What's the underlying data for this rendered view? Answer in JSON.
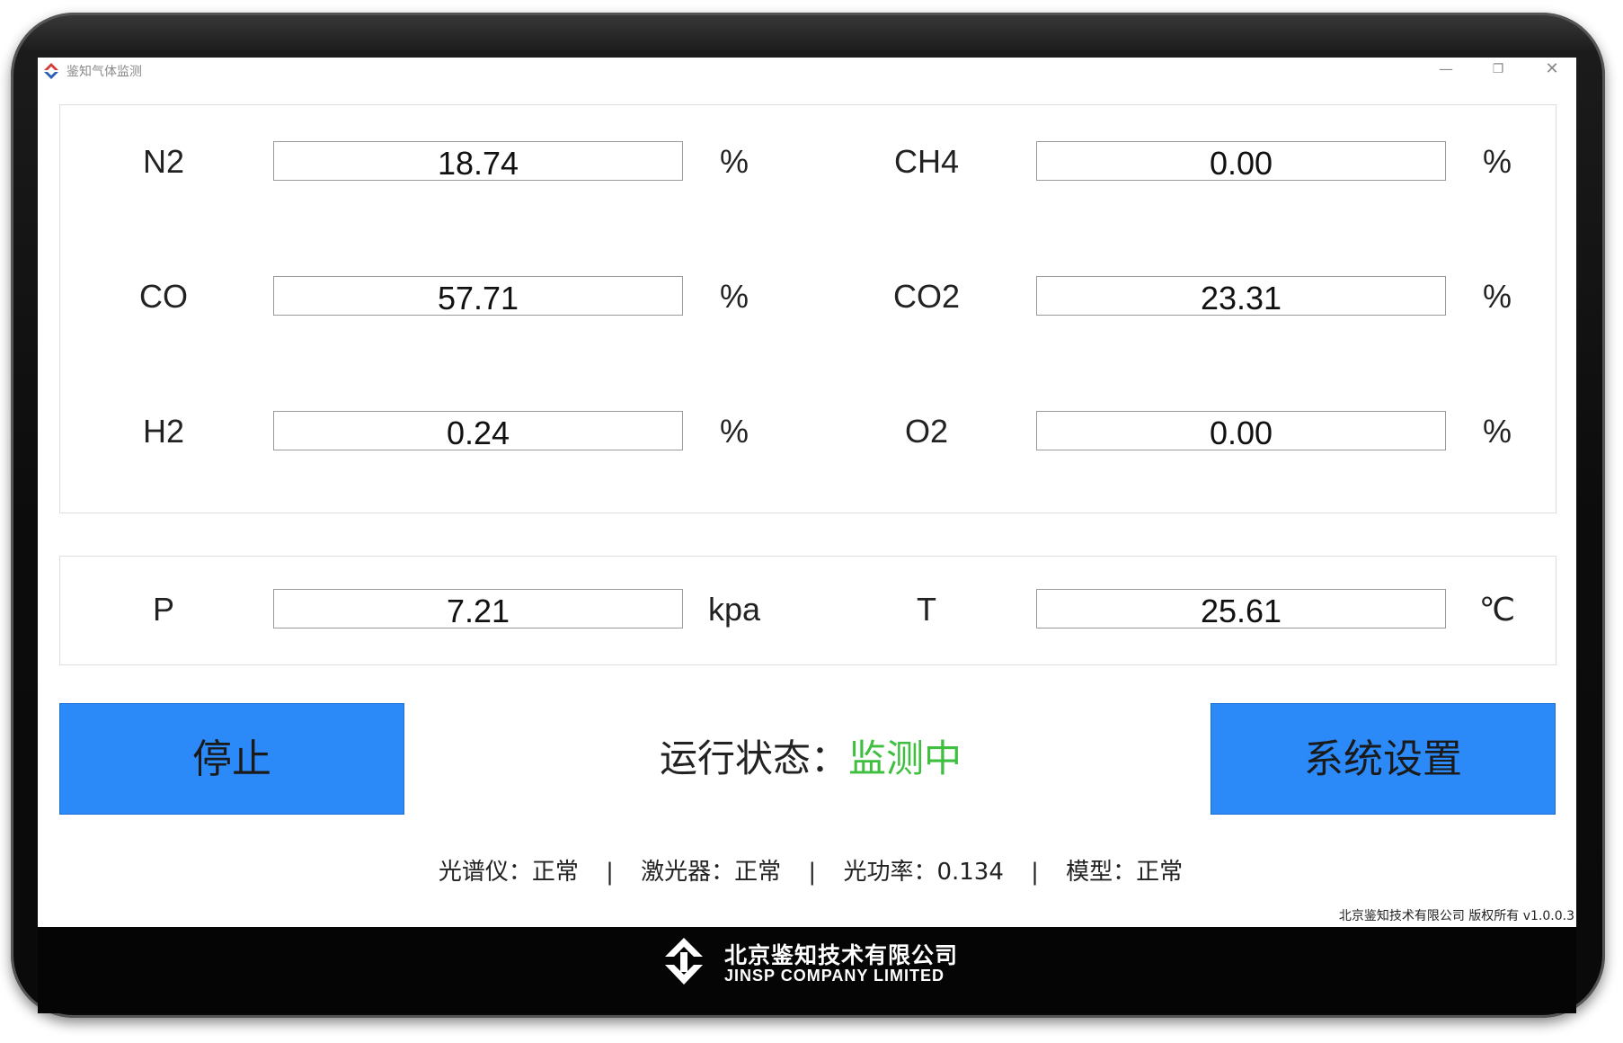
{
  "window": {
    "title": "鉴知气体监测",
    "minimize_glyph": "—",
    "maximize_glyph": "❐",
    "close_glyph": "✕"
  },
  "gas_readings": [
    {
      "label": "N2",
      "value": "18.74",
      "unit": "%"
    },
    {
      "label": "CH4",
      "value": "0.00",
      "unit": "%"
    },
    {
      "label": "CO",
      "value": "57.71",
      "unit": "%"
    },
    {
      "label": "CO2",
      "value": "23.31",
      "unit": "%"
    },
    {
      "label": "H2",
      "value": "0.24",
      "unit": "%"
    },
    {
      "label": "O2",
      "value": "0.00",
      "unit": "%"
    }
  ],
  "environment": [
    {
      "label": "P",
      "value": "7.21",
      "unit": "kpa"
    },
    {
      "label": "T",
      "value": "25.61",
      "unit": "℃"
    }
  ],
  "controls": {
    "stop_label": "停止",
    "settings_label": "系统设置"
  },
  "status": {
    "label": "运行状态：",
    "value": "监测中",
    "value_color": "#3fbf3f"
  },
  "diagnostics": {
    "spectrometer": "光谱仪：正常",
    "laser": "激光器：正常",
    "optical_power": "光功率：0.134",
    "model": "模型：正常",
    "separator": "|"
  },
  "copyright": "北京鉴知技术有限公司 版权所有 v1.0.0.3",
  "footer": {
    "company_cn": "北京鉴知技术有限公司",
    "company_en": "JINSP COMPANY LIMITED"
  },
  "colors": {
    "button_blue": "#2b8af7",
    "status_green": "#3fbf3f"
  }
}
